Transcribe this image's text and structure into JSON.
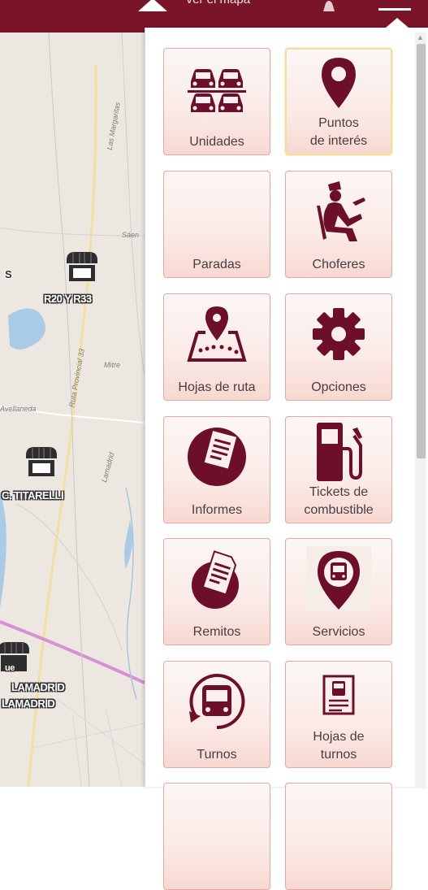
{
  "header": {
    "title": "Ver el mapa"
  },
  "map": {
    "road_labels": [
      "Las Margaritas",
      "Ruta Provincial 33",
      "Mitre",
      "Sáen",
      "Avellaneda",
      "Lamadrid"
    ],
    "city_names": [
      "S",
      "LAMADRID",
      "LAMADRID"
    ],
    "pois": [
      {
        "label": "R20 Y R33"
      },
      {
        "label": "C. TITARELLI"
      },
      {
        "label": "ue"
      }
    ]
  },
  "menu": {
    "tiles": [
      {
        "label": "Unidades",
        "icon": "vehicles-icon",
        "selected": false
      },
      {
        "label": "Puntos de interés",
        "icon": "location-pin-icon",
        "selected": true
      },
      {
        "label": "Paradas",
        "icon": "stop-icon",
        "selected": false
      },
      {
        "label": "Choferes",
        "icon": "driver-icon",
        "selected": false
      },
      {
        "label": "Hojas de ruta",
        "icon": "route-map-icon",
        "selected": false
      },
      {
        "label": "Opciones",
        "icon": "gear-icon",
        "selected": false
      },
      {
        "label": "Informes",
        "icon": "report-icon",
        "selected": false
      },
      {
        "label": "Tickets de combustible",
        "icon": "fuel-pump-icon",
        "selected": false
      },
      {
        "label": "Remitos",
        "icon": "delivery-note-icon",
        "selected": false
      },
      {
        "label": "Servicios",
        "icon": "bus-pin-icon",
        "selected": false
      },
      {
        "label": "Turnos",
        "icon": "bus-cycle-icon",
        "selected": false
      },
      {
        "label": "Hojas de turnos",
        "icon": "shift-sheet-icon",
        "selected": false
      }
    ]
  },
  "colors": {
    "brand": "#7a1428",
    "icon": "#6d0f2a",
    "tile_border": "#e6a79f"
  }
}
